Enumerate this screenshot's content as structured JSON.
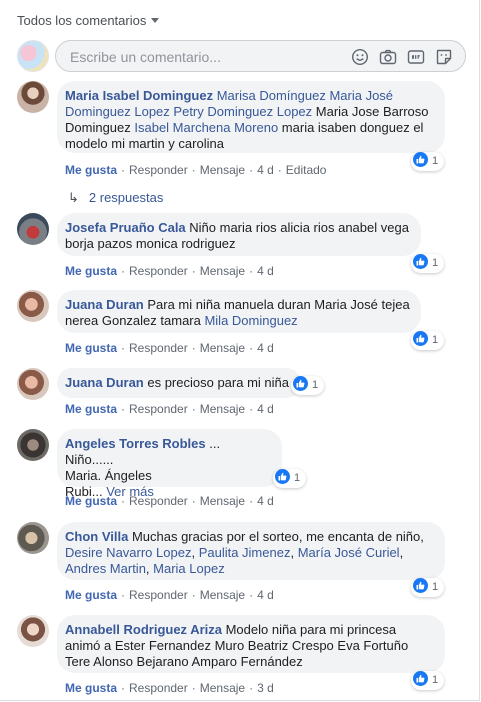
{
  "filter": {
    "label": "Todos los comentarios"
  },
  "composer": {
    "placeholder": "Escribe un comentario..."
  },
  "comments": [
    {
      "author": "Maria Isabel Dominguez",
      "parts": [
        {
          "t": " ",
          "k": "txt"
        },
        {
          "t": "Marisa Domínguez",
          "k": "tag"
        },
        {
          "t": " ",
          "k": "txt"
        },
        {
          "t": "Maria José Dominguez Lopez",
          "k": "tag"
        },
        {
          "t": " ",
          "k": "txt"
        },
        {
          "t": "Petry Dominguez Lopez",
          "k": "tag"
        },
        {
          "t": " Maria Jose Barroso Dominguez ",
          "k": "txt"
        },
        {
          "t": "Isabel Marchena Moreno",
          "k": "tag"
        },
        {
          "t": " maria isaben donguez el modelo mi martin y carolina",
          "k": "txt"
        }
      ],
      "like": "Me gusta",
      "reply": "Responder",
      "message": "Mensaje",
      "time": "4 d",
      "edited": "Editado",
      "reactions": "1"
    },
    {
      "author": "Josefa Pruaño Cala",
      "parts": [
        {
          "t": " Niño maria rios alicia rios anabel vega borja pazos monica rodriguez",
          "k": "txt"
        }
      ],
      "like": "Me gusta",
      "reply": "Responder",
      "message": "Mensaje",
      "time": "4 d",
      "reactions": "1"
    },
    {
      "author": "Juana Duran",
      "parts": [
        {
          "t": " Para mi niña manuela duran Maria José tejea nerea Gonzalez tamara ",
          "k": "txt"
        },
        {
          "t": "Mila Dominguez",
          "k": "tag"
        }
      ],
      "like": "Me gusta",
      "reply": "Responder",
      "message": "Mensaje",
      "time": "4 d",
      "reactions": "1"
    },
    {
      "author": "Juana Duran",
      "parts": [
        {
          "t": " es precioso para mi niña",
          "k": "txt"
        }
      ],
      "like": "Me gusta",
      "reply": "Responder",
      "message": "Mensaje",
      "time": "4 d",
      "reactions": "1"
    },
    {
      "author": "Angeles Torres Robles",
      "parts": [
        {
          "t": " ... Niño......",
          "k": "txt"
        }
      ],
      "line2": "Maria. Ángeles",
      "line3": "Rubi...",
      "see_more": "Ver más",
      "like": "Me gusta",
      "reply": "Responder",
      "message": "Mensaje",
      "time": "4 d",
      "reactions": "1"
    },
    {
      "author": "Chon Villa",
      "parts": [
        {
          "t": " Muchas gracias por el sorteo, me encanta de niño, ",
          "k": "txt"
        },
        {
          "t": "Desire Navarro Lopez",
          "k": "tag"
        },
        {
          "t": ", ",
          "k": "txt"
        },
        {
          "t": "Paulita Jimenez",
          "k": "tag"
        },
        {
          "t": ", ",
          "k": "txt"
        },
        {
          "t": "María José Curiel",
          "k": "tag"
        },
        {
          "t": ", ",
          "k": "txt"
        },
        {
          "t": "Andres Martin",
          "k": "tag"
        },
        {
          "t": ", ",
          "k": "txt"
        },
        {
          "t": "Maria Lopez",
          "k": "tag"
        }
      ],
      "like": "Me gusta",
      "reply": "Responder",
      "message": "Mensaje",
      "time": "4 d",
      "reactions": "1"
    },
    {
      "author": "Annabell Rodriguez Ariza",
      "parts": [
        {
          "t": " Modelo niña para mi princesa animó a Ester Fernandez Muro Beatriz Crespo Eva Fortuño Tere Alonso Bejarano Amparo Fernández",
          "k": "txt"
        }
      ],
      "like": "Me gusta",
      "reply": "Responder",
      "message": "Mensaje",
      "time": "3 d",
      "reactions": "1"
    }
  ],
  "replies_label": "2 respuestas",
  "colors": {
    "link": "#385898",
    "like_blue": "#1877f2",
    "bubble": "#f2f3f5"
  }
}
